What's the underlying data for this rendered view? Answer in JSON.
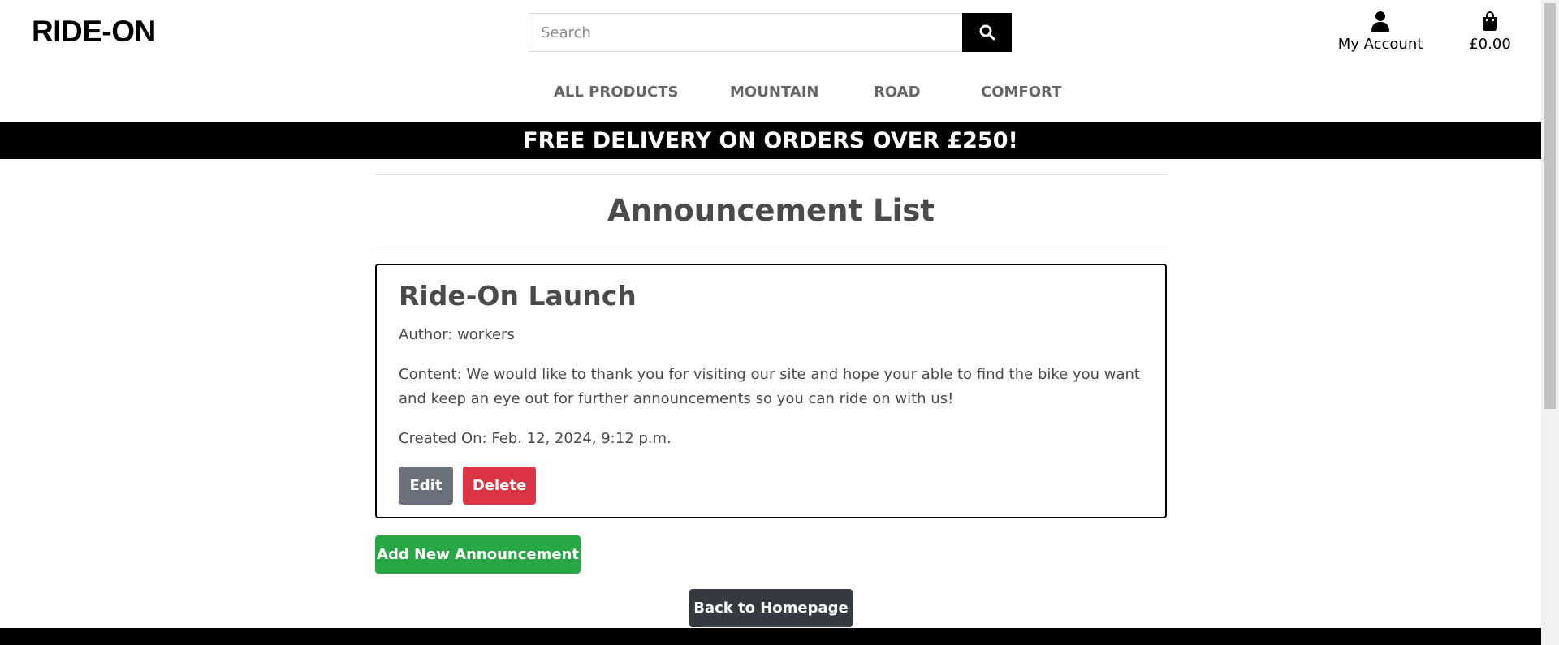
{
  "header": {
    "logo": "RIDE-ON",
    "search": {
      "placeholder": "Search",
      "value": "",
      "button_icon": "search-icon"
    },
    "account": {
      "label": "My Account",
      "icon": "user-icon"
    },
    "cart": {
      "total": "£0.00",
      "icon": "shopping-bag-icon"
    }
  },
  "nav": {
    "items": [
      {
        "label": "ALL PRODUCTS"
      },
      {
        "label": "MOUNTAIN"
      },
      {
        "label": "ROAD"
      },
      {
        "label": "COMFORT"
      }
    ]
  },
  "banner": {
    "text": "FREE DELIVERY ON ORDERS OVER £250!"
  },
  "main": {
    "title": "Announcement List",
    "announcements": [
      {
        "title": "Ride-On Launch",
        "author": "Author: workers",
        "content": "Content: We would like to thank you for visiting our site and hope your able to find the bike you want and keep an eye out for further announcements so you can ride on with us!",
        "created": "Created On: Feb. 12, 2024, 9:12 p.m.",
        "edit_label": "Edit",
        "delete_label": "Delete"
      }
    ],
    "add_label": "Add New Announcement",
    "home_label": "Back to Homepage"
  },
  "colors": {
    "edit": "#6b717a",
    "delete": "#db3545",
    "add": "#28a745",
    "home": "#343a40",
    "banner": "#000000"
  }
}
